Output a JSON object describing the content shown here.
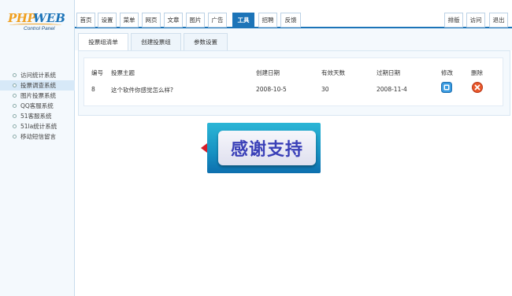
{
  "logo": {
    "php": "PHP",
    "web": "WEB",
    "subtitle": "Control Panel"
  },
  "sidebar": {
    "items": [
      {
        "label": "访问统计系统",
        "active": false
      },
      {
        "label": "投票调查系统",
        "active": true
      },
      {
        "label": "图片投票系统",
        "active": false
      },
      {
        "label": "QQ客服系统",
        "active": false
      },
      {
        "label": "51客服系统",
        "active": false
      },
      {
        "label": "51la统计系统",
        "active": false
      },
      {
        "label": "移动短信留言",
        "active": false
      }
    ]
  },
  "topnav": {
    "tabs": [
      "首页",
      "设置",
      "菜单",
      "网页",
      "文章",
      "图片",
      "广告",
      "工具",
      "招聘",
      "反馈"
    ],
    "active_tab": "工具",
    "right_tabs": [
      "排版",
      "访问",
      "退出"
    ]
  },
  "subnav": {
    "tabs": [
      "投票组清单",
      "创建投票组",
      "参数设置"
    ],
    "active_tab": "投票组清单"
  },
  "table": {
    "headers": {
      "id": "编号",
      "subject": "投票主题",
      "created": "创建日期",
      "days": "有效天数",
      "expires": "过期日期",
      "edit": "修改",
      "delete": "删除"
    },
    "rows": [
      {
        "id": "8",
        "subject": "这个软件你感觉怎么样?",
        "created": "2008-10-5",
        "days": "30",
        "expires": "2008-11-4"
      }
    ]
  },
  "banner": {
    "text": "感谢支持"
  },
  "colors": {
    "accent": "#1c74b8",
    "edit_icon": "#3a9be0",
    "delete_icon": "#e8572a",
    "banner": "#1690c2"
  }
}
